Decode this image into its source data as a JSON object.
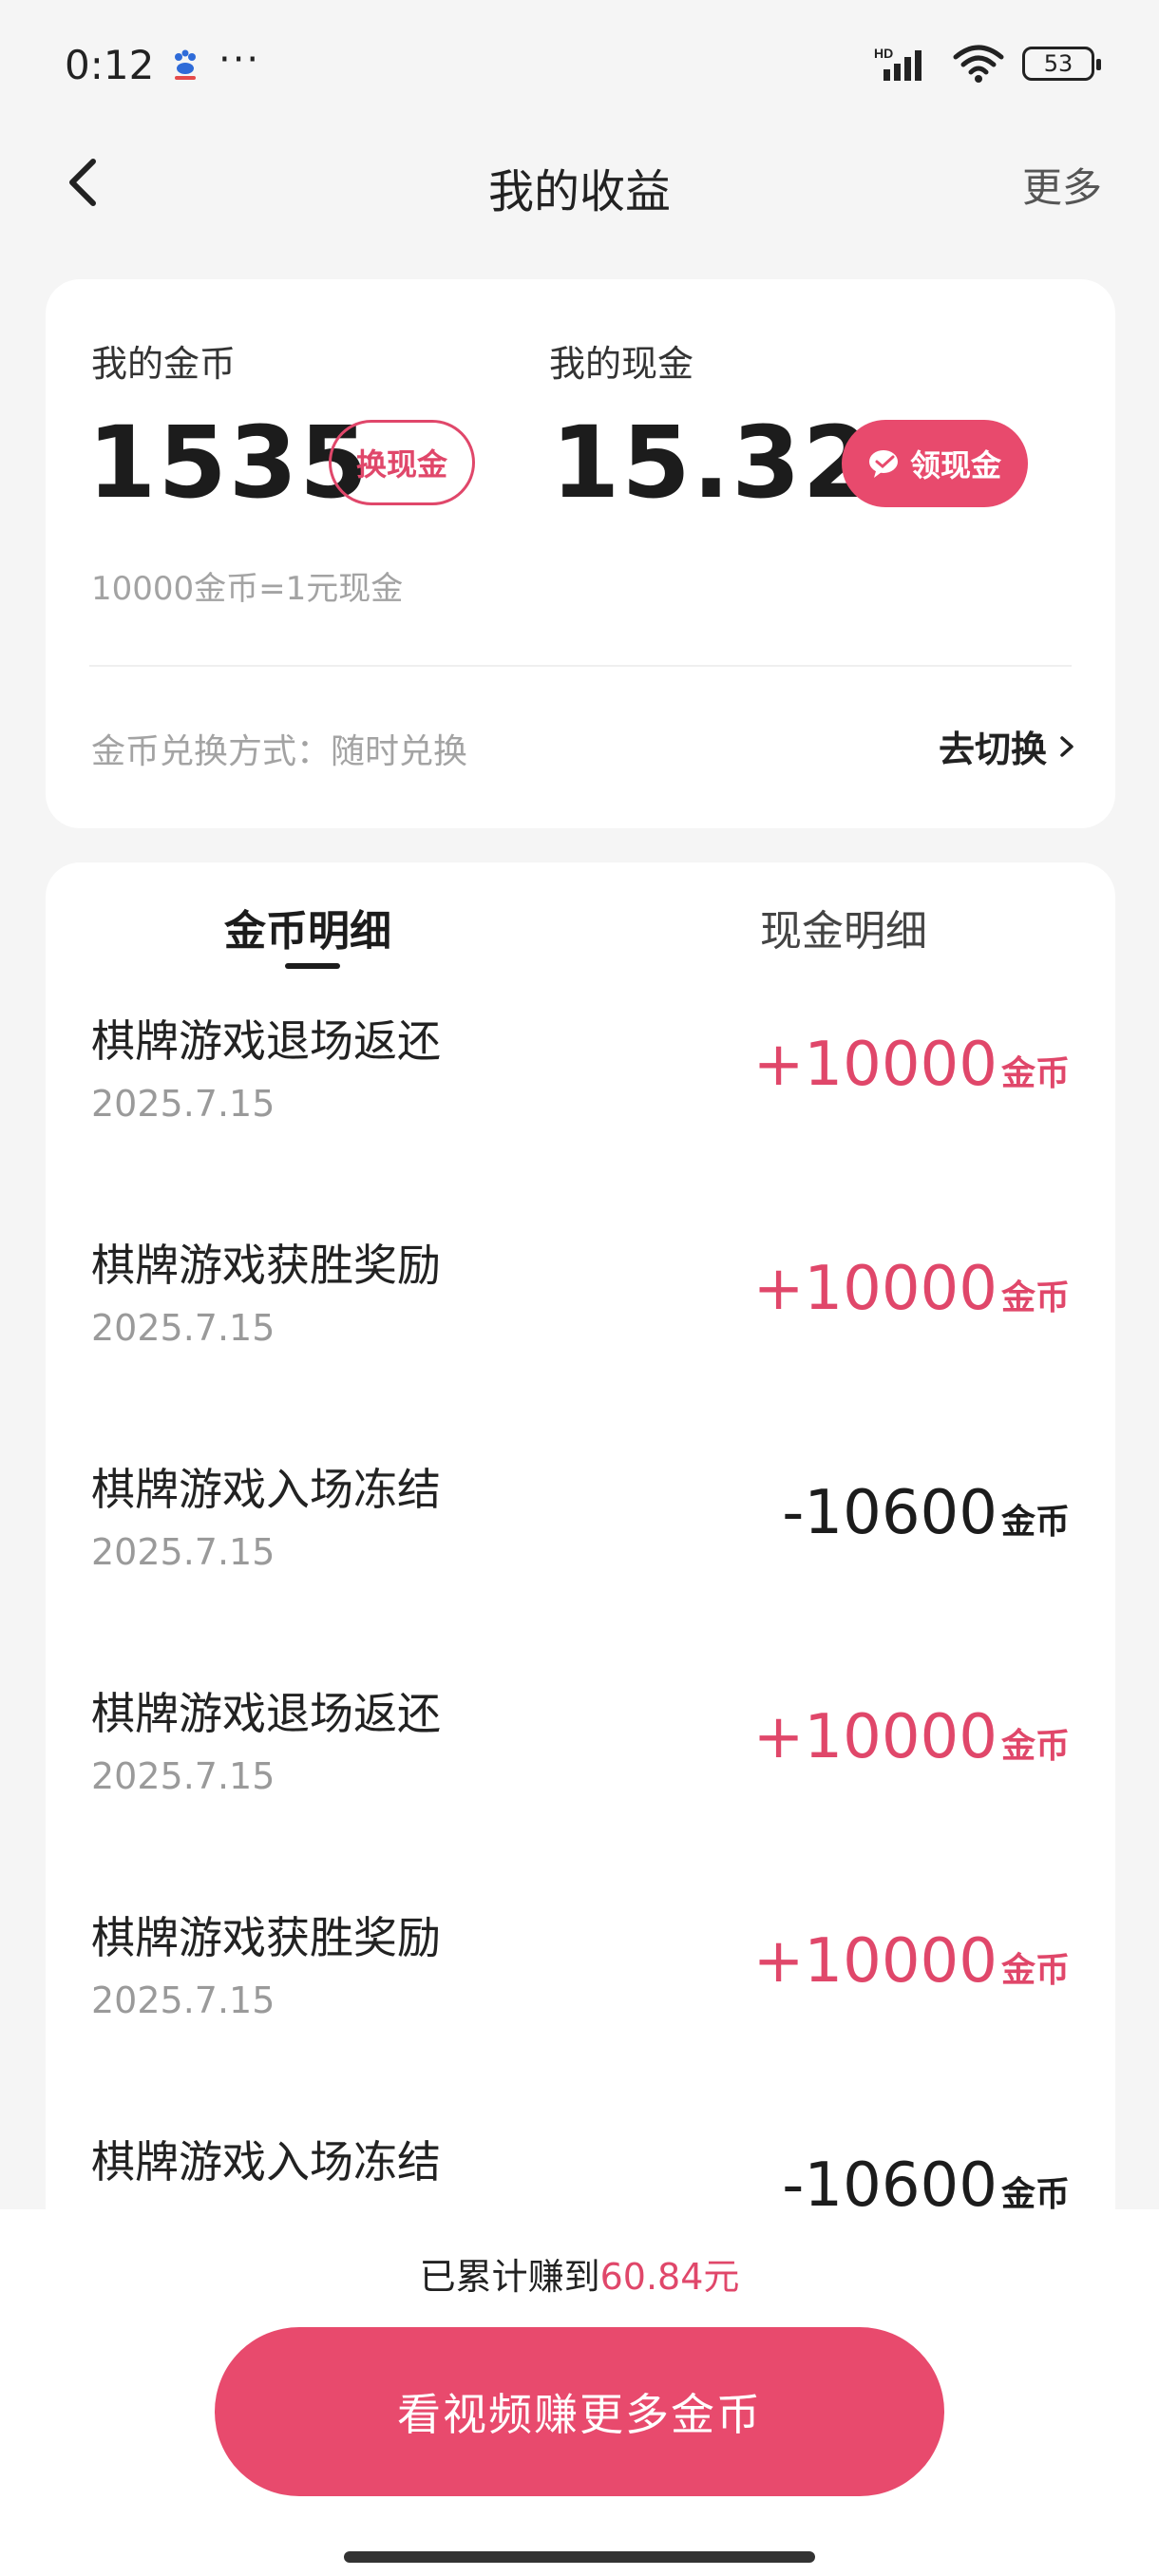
{
  "status_bar": {
    "time": "0:12",
    "dots": "···",
    "battery": "53",
    "signal_label": "HD"
  },
  "nav": {
    "title": "我的收益",
    "more": "更多"
  },
  "summary": {
    "coins_label": "我的金币",
    "coins_value": "1535",
    "to_cash_button": "换现金",
    "cash_label": "我的现金",
    "cash_value": "15.32",
    "claim_cash_button": "领现金",
    "rate_text": "10000金币=1元现金",
    "exchange_mode": "金币兑换方式：随时兑换",
    "switch_link": "去切换"
  },
  "tabs": {
    "coin_detail": "金币明细",
    "cash_detail": "现金明细"
  },
  "records": [
    {
      "title": "棋牌游戏退场返还",
      "date": "2025.7.15",
      "amount": "+10000",
      "unit": "金币",
      "sign": "pos"
    },
    {
      "title": "棋牌游戏获胜奖励",
      "date": "2025.7.15",
      "amount": "+10000",
      "unit": "金币",
      "sign": "pos"
    },
    {
      "title": "棋牌游戏入场冻结",
      "date": "2025.7.15",
      "amount": "-10600",
      "unit": "金币",
      "sign": "neg"
    },
    {
      "title": "棋牌游戏退场返还",
      "date": "2025.7.15",
      "amount": "+10000",
      "unit": "金币",
      "sign": "pos"
    },
    {
      "title": "棋牌游戏获胜奖励",
      "date": "2025.7.15",
      "amount": "+10000",
      "unit": "金币",
      "sign": "pos"
    },
    {
      "title": "棋牌游戏入场冻结",
      "date": "",
      "amount": "-10600",
      "unit": "金币",
      "sign": "neg"
    }
  ],
  "bottom": {
    "earned_prefix": "已累计赚到",
    "earned_value": "60.84元",
    "cta": "看视频赚更多金币"
  },
  "colors": {
    "accent": "#e84a6d",
    "positive": "#e0476a",
    "negative": "#1c1c1c",
    "background": "#f5f5f5"
  },
  "icons": {
    "back": "chevron-left-icon",
    "chevron": "chevron-right-icon",
    "wechat": "wechat-icon",
    "wifi": "wifi-icon",
    "signal": "signal-icon",
    "battery": "battery-icon",
    "app": "baidu-paw-icon"
  }
}
